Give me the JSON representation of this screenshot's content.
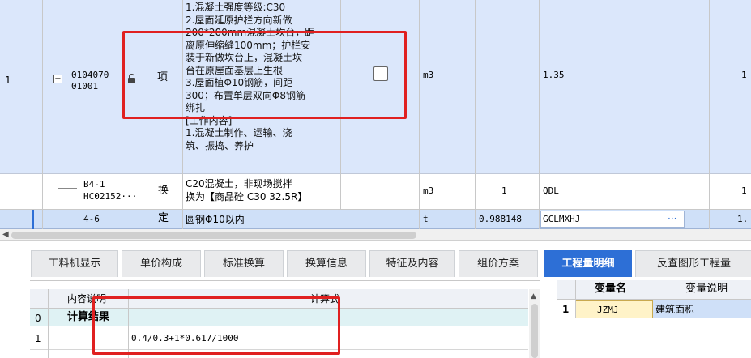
{
  "grid": {
    "row1": {
      "index": "1",
      "code_line1": "0104070",
      "code_line2": "01001",
      "type": "项",
      "description_lines": [
        "1.混凝土强度等级:C30",
        "2.屋面延原护栏方向新做",
        "200*200mm混凝土坎台，距",
        "离原伸缩缝100mm；护栏安",
        "装于新做坎台上，混凝土坎",
        "台在原屋面基层上生根",
        "3.屋面植Φ10钢筋，间距",
        "300；布置单层双向Φ8钢筋",
        "绑扎",
        "[工作内容]",
        "1.混凝土制作、运输、浇",
        "筑、振捣、养护"
      ],
      "unit": "m3",
      "quantity": "1.35",
      "right_value": "1"
    },
    "row2": {
      "code_line1": "B4-1",
      "code_line2": "HC02152···",
      "type": "换",
      "desc_line1": "C20混凝土，非现场搅拌",
      "desc_line2": "换为【商品砼 C30 32.5R】",
      "unit": "m3",
      "factor": "1",
      "expression": "QDL",
      "right_value": "1"
    },
    "row3": {
      "code": "4-6",
      "type": "定",
      "desc": "圆钢Φ10以内",
      "unit": "t",
      "factor": "0.988148",
      "expression": "GCLMXHJ",
      "ellipsis": "···",
      "right_value": "1."
    }
  },
  "tabs": [
    {
      "label": "工料机显示"
    },
    {
      "label": "单价构成"
    },
    {
      "label": "标准换算"
    },
    {
      "label": "换算信息"
    },
    {
      "label": "特征及内容"
    },
    {
      "label": "组价方案"
    },
    {
      "label": "工程量明细"
    },
    {
      "label": "反查图形工程量"
    }
  ],
  "detail": {
    "col_desc": "内容说明",
    "col_formula": "计算式",
    "rows": [
      {
        "index": "0",
        "desc": "计算结果",
        "formula": ""
      },
      {
        "index": "1",
        "desc": "",
        "formula": "0.4/0.3+1*0.617/1000"
      }
    ]
  },
  "vars": {
    "col_name": "变量名",
    "col_desc": "变量说明",
    "rows": [
      {
        "index": "1",
        "name": "JZMJ",
        "desc": "建筑面积"
      }
    ]
  },
  "colors": {
    "accent": "#2d6fd6",
    "highlight": "#e02020",
    "selected_row": "#dbe7fb"
  }
}
